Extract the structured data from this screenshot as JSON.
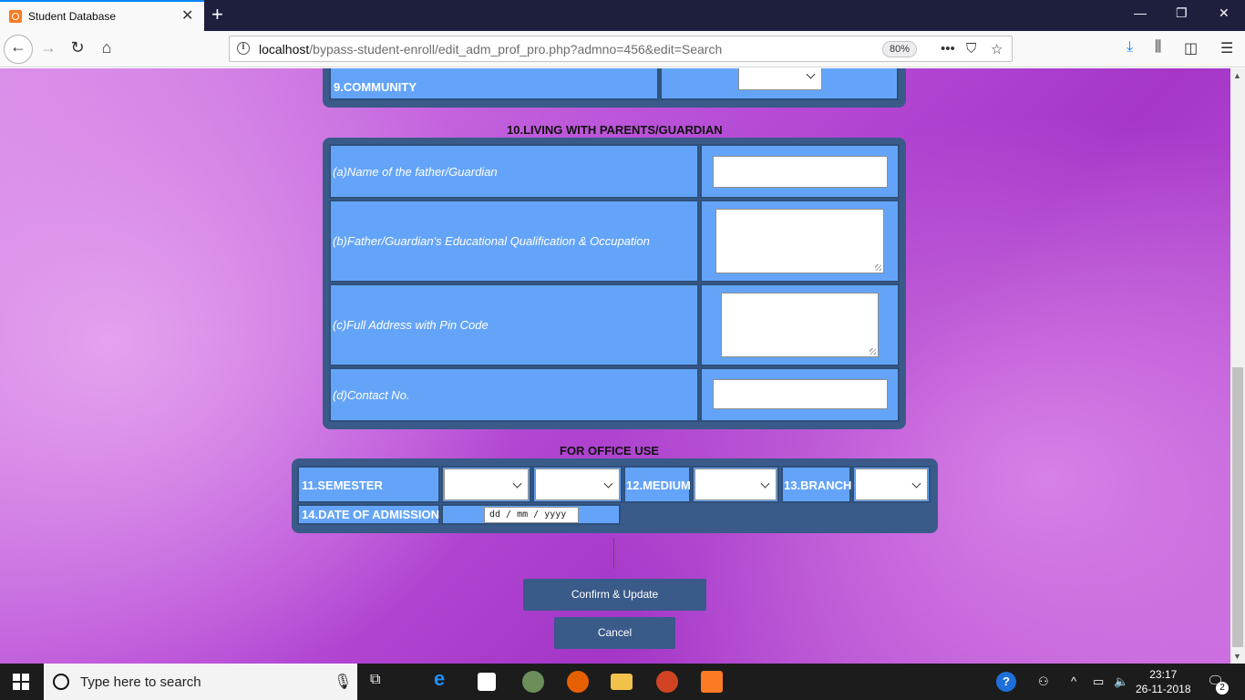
{
  "browser": {
    "tab_title": "Student Database",
    "url_host": "localhost",
    "url_path": "/bypass-student-enroll/edit_adm_prof_pro.php?admno=456&edit=Search",
    "zoom": "80%"
  },
  "form": {
    "community_label": "9.COMMUNITY",
    "parents_heading": "10.LIVING WITH PARENTS/GUARDIAN",
    "father_name_label": "(a)Name of the father/Guardian",
    "father_qual_label": "(b)Father/Guardian's Educational Qualification & Occupation",
    "address_label": "(c)Full Address with Pin Code",
    "contact_label": "(d)Contact No.",
    "office_heading": "FOR OFFICE USE",
    "semester_label": "11.SEMESTER",
    "medium_label": "12.MEDIUM",
    "branch_label": "13.BRANCH",
    "admission_date_label": "14.DATE OF ADMISSION",
    "date_placeholder": "dd / mm / yyyy",
    "confirm_button": "Confirm & Update",
    "cancel_button": "Cancel"
  },
  "taskbar": {
    "search_placeholder": "Type here to search",
    "time": "23:17",
    "date": "26-11-2018",
    "notification_count": "2"
  }
}
